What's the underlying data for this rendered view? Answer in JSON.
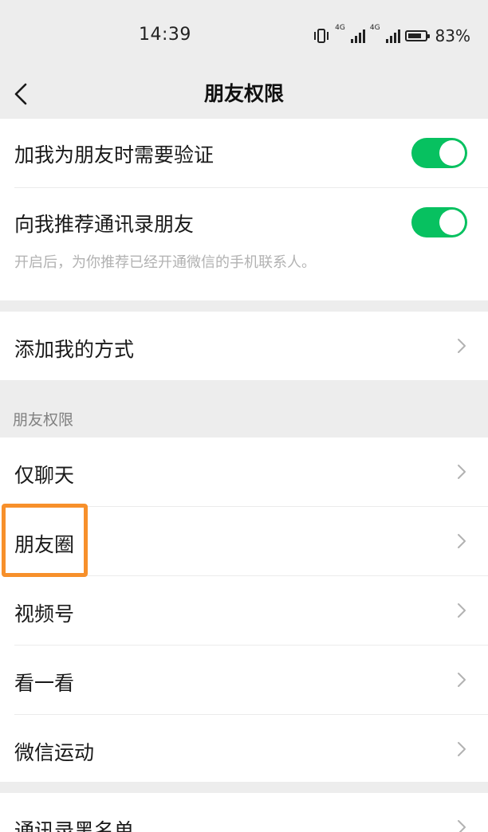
{
  "status_bar": {
    "time": "14:39",
    "network_label_1": "4G",
    "network_label_2": "4G",
    "battery_percent": "83%",
    "battery_level": 0.83
  },
  "nav": {
    "back_icon": "chevron-left-icon",
    "title": "朋友权限"
  },
  "privacy_toggles": [
    {
      "label": "加我为朋友时需要验证",
      "enabled": true
    },
    {
      "label": "向我推荐通讯录朋友",
      "subtitle": "开启后，为你推荐已经开通微信的手机联系人。",
      "enabled": true
    }
  ],
  "add_method": {
    "label": "添加我的方式"
  },
  "friend_permissions": {
    "header": "朋友权限",
    "items": [
      {
        "label": "仅聊天"
      },
      {
        "label": "朋友圈",
        "highlighted": true
      },
      {
        "label": "视频号"
      },
      {
        "label": "看一看"
      },
      {
        "label": "微信运动"
      }
    ]
  },
  "blacklist": {
    "label": "通讯录黑名单"
  },
  "colors": {
    "toggle_on": "#07c160",
    "highlight_border": "#f7902b",
    "background": "#ededed"
  }
}
